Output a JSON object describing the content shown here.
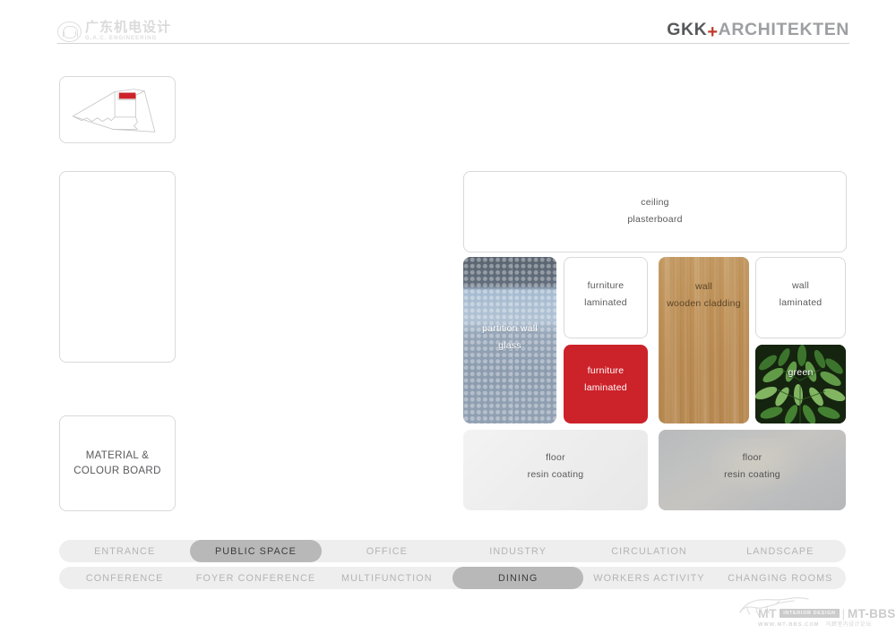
{
  "header": {
    "client_logo": {
      "icon": "company-seal-icon",
      "cn_name": "广东机电设计",
      "en_name": "G.A.C. ENGINEERING"
    },
    "brand": {
      "primary": "GKK",
      "separator": "+",
      "secondary": "ARCHITEKTEN",
      "accent_color": "#c0392b"
    }
  },
  "sidebar": {
    "plan_thumbnail_name": "site-plan-thumbnail",
    "blank_panel_name": "blank-panel",
    "board_title_line1": "MATERIAL &",
    "board_title_line2": "COLOUR BOARD"
  },
  "materials": [
    {
      "id": "ceiling",
      "line1": "ceiling",
      "line2": "plasterboard",
      "swatch_type": "plain-white",
      "color": "#ffffff"
    },
    {
      "id": "partition-wall-glass",
      "line1": "partition wall",
      "line2": "glass",
      "swatch_type": "dotted-glass",
      "color": "#8c9aad"
    },
    {
      "id": "furniture-laminated-white",
      "line1": "furniture",
      "line2": "laminated",
      "swatch_type": "plain-white",
      "color": "#ffffff"
    },
    {
      "id": "furniture-laminated-red",
      "line1": "furniture",
      "line2": "laminated",
      "swatch_type": "solid",
      "color": "#cc2229"
    },
    {
      "id": "wall-wooden-cladding",
      "line1": "wall",
      "line2": "wooden cladding",
      "swatch_type": "wood-grain",
      "color": "#c09258"
    },
    {
      "id": "wall-laminated",
      "line1": "wall",
      "line2": "laminated",
      "swatch_type": "plain-white",
      "color": "#ffffff"
    },
    {
      "id": "green",
      "line1": "green",
      "line2": "",
      "swatch_type": "photo-plant",
      "color": "#2d5a22"
    },
    {
      "id": "floor-resin-light",
      "line1": "floor",
      "line2": "resin coating",
      "swatch_type": "resin-light",
      "color": "#eeeeee"
    },
    {
      "id": "floor-resin-grey",
      "line1": "floor",
      "line2": "resin coating",
      "swatch_type": "resin-grey",
      "color": "#bdbebf"
    }
  ],
  "nav": {
    "row1": [
      {
        "label": "ENTRANCE",
        "active": false
      },
      {
        "label": "PUBLIC SPACE",
        "active": true
      },
      {
        "label": "OFFICE",
        "active": false
      },
      {
        "label": "INDUSTRY",
        "active": false
      },
      {
        "label": "CIRCULATION",
        "active": false
      },
      {
        "label": "LANDSCAPE",
        "active": false
      }
    ],
    "row2": [
      {
        "label": "CONFERENCE",
        "active": false
      },
      {
        "label": "FOYER CONFERENCE",
        "active": false
      },
      {
        "label": "MULTIFUNCTION",
        "active": false
      },
      {
        "label": "DINING",
        "active": true
      },
      {
        "label": "WORKERS ACTIVITY",
        "active": false
      },
      {
        "label": "CHANGING ROOMS",
        "active": false
      }
    ],
    "active_color": "#b8b8b8",
    "track_color": "#eeeeee"
  },
  "watermark": {
    "mark": "MT",
    "badge": "INTERIOR DESIGN",
    "separator": "|",
    "site": "MT-BBS",
    "url": "WWW.MT-BBS.COM",
    "cn_site": "马蹄室内设计论坛"
  }
}
